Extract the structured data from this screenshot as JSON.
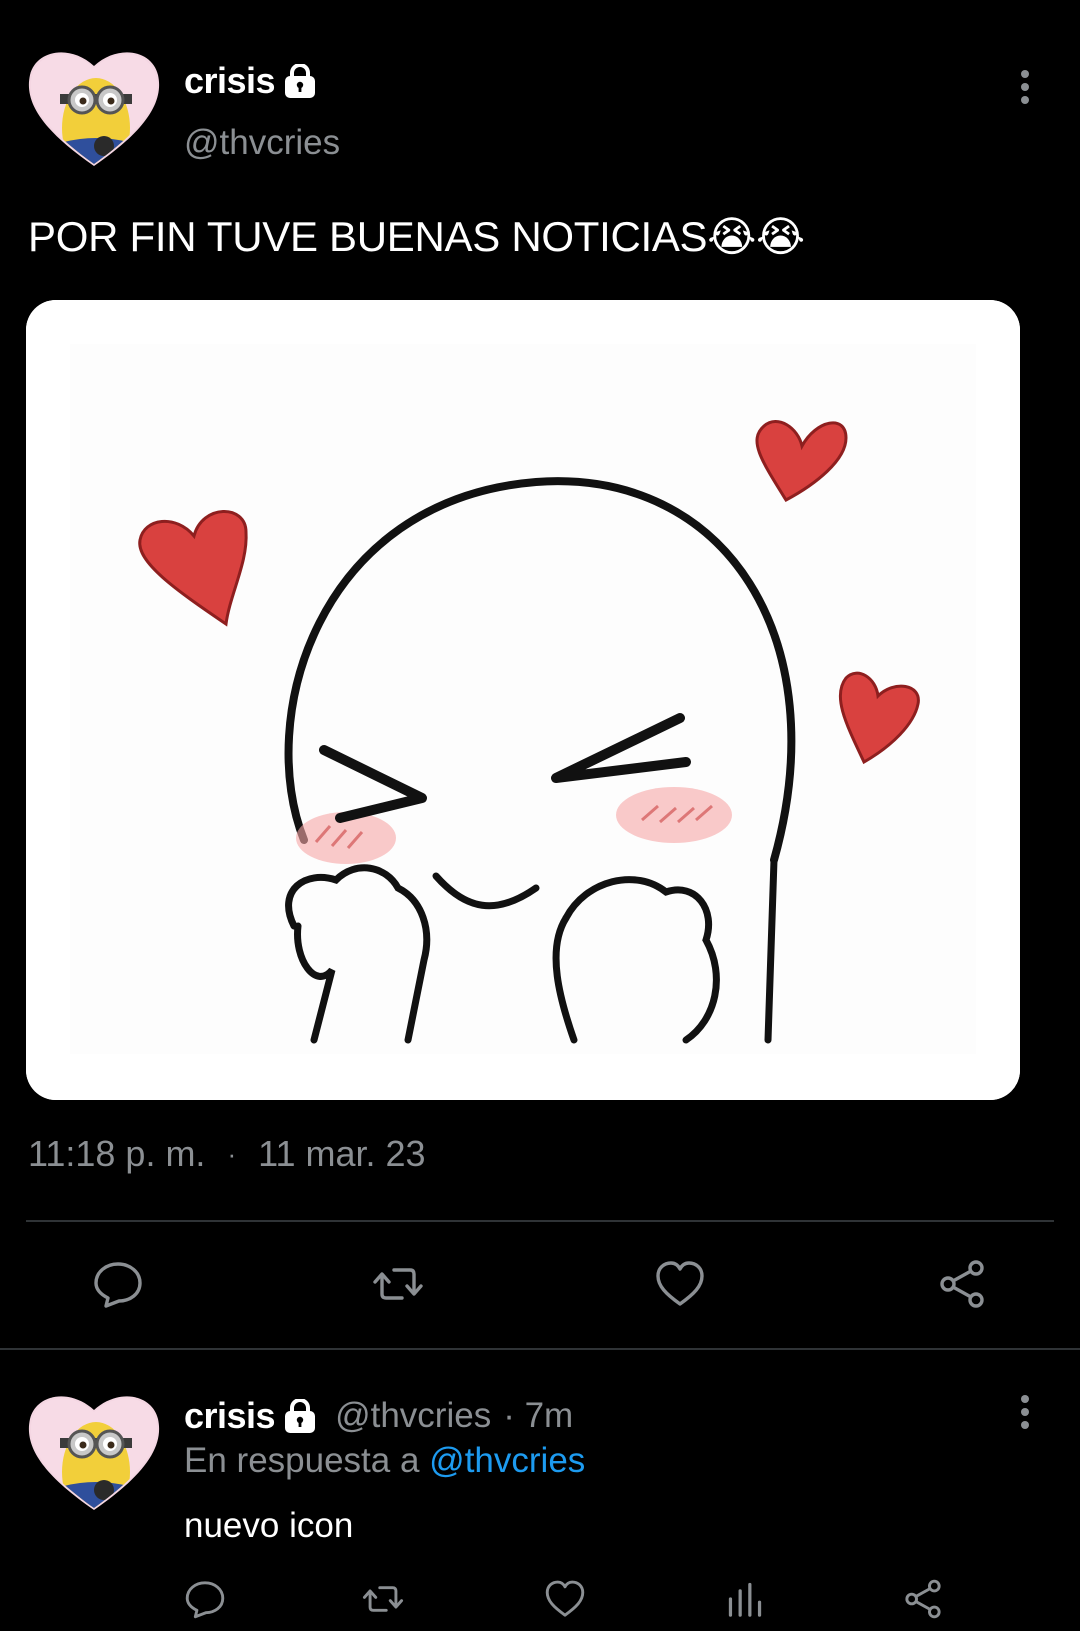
{
  "main_tweet": {
    "author": {
      "display_name": "crisis",
      "handle": "@thvcries",
      "protected_icon": "lock-icon",
      "avatar": "minion-heart-avatar"
    },
    "text": "POR FIN TUVE BUENAS NOTICIAS😭😭",
    "media": {
      "description_icon": "blushing-face-with-hearts-image"
    },
    "time": "11:18 p. m.",
    "separator": "·",
    "date": "11 mar. 23",
    "actions": [
      "reply-icon",
      "retweet-icon",
      "like-icon",
      "share-icon"
    ],
    "more_icon": "more-vertical-icon"
  },
  "reply_tweet": {
    "author": {
      "display_name": "crisis",
      "handle": "@thvcries",
      "protected_icon": "lock-icon",
      "avatar": "minion-heart-avatar"
    },
    "time_ago": "· 7m",
    "in_reply_prefix": "En respuesta a",
    "in_reply_handle": "@thvcries",
    "text": "nuevo icon",
    "actions": [
      "reply-icon",
      "retweet-icon",
      "like-icon",
      "analytics-icon",
      "share-icon"
    ],
    "more_icon": "more-vertical-icon"
  },
  "colors": {
    "background": "#000000",
    "text_primary": "#ffffff",
    "text_secondary": "#8b8f93",
    "link": "#1d9bf0",
    "divider": "#2f3336",
    "heart_red": "#d9413f"
  }
}
